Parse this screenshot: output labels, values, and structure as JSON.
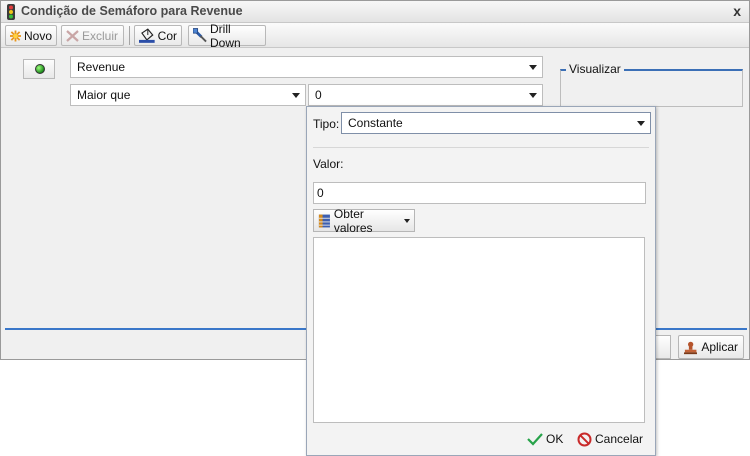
{
  "window": {
    "title": "Condição de Semáforo para Revenue",
    "close_label": "x"
  },
  "toolbar": {
    "novo": "Novo",
    "excluir": "Excluir",
    "cor": "Cor",
    "drill_down": "Drill Down"
  },
  "condition": {
    "measure": "Revenue",
    "operator": "Maior que",
    "value": "0"
  },
  "preview": {
    "legend": "Visualizar"
  },
  "footer": {
    "apply": "Aplicar"
  },
  "popup": {
    "tipo_label": "Tipo:",
    "tipo_value": "Constante",
    "valor_label": "Valor:",
    "valor_value": "0",
    "obter_button": "Obter valores",
    "ok": "OK",
    "cancel": "Cancelar"
  },
  "colors": {
    "accent": "#3a77c9",
    "indicator": "#1d8a1d"
  }
}
